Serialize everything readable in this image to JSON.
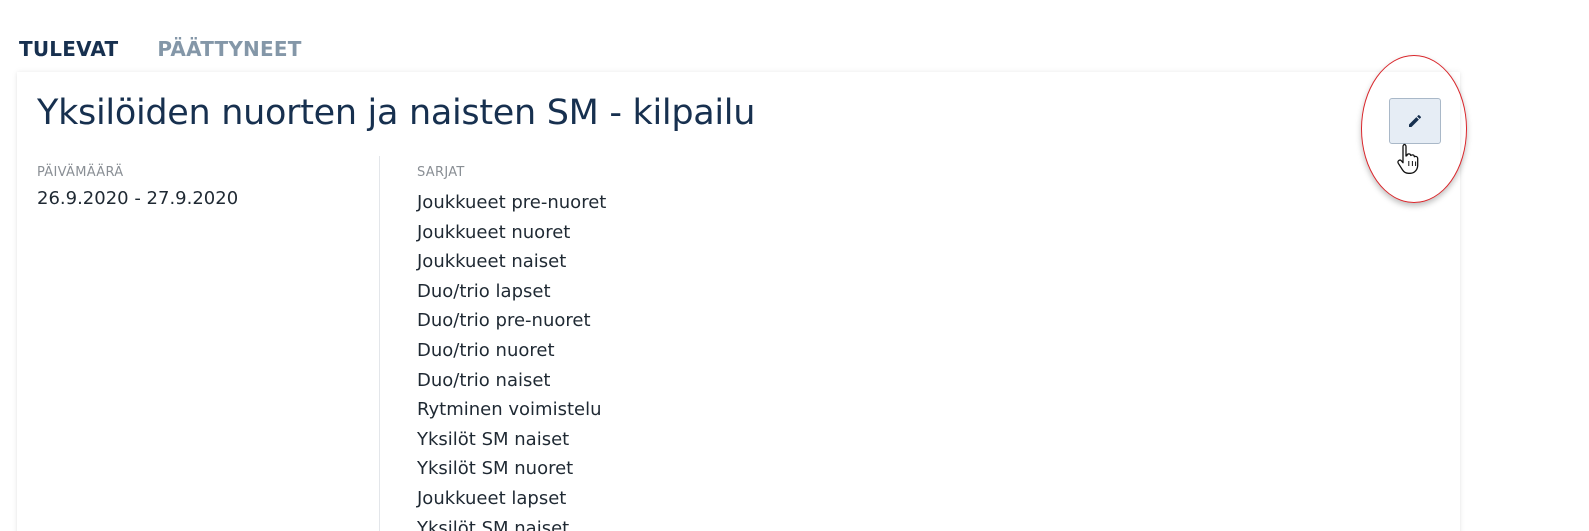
{
  "tabs": [
    {
      "label": "TULEVAT",
      "active": true
    },
    {
      "label": "PÄÄTTYNEET",
      "active": false
    }
  ],
  "competition": {
    "title": "Yksilöiden nuorten ja naisten SM - kilpailu",
    "date_label": "PÄIVÄMÄÄRÄ",
    "date_value": "26.9.2020 - 27.9.2020",
    "series_label": "SARJAT",
    "series": [
      "Joukkueet pre-nuoret",
      "Joukkueet nuoret",
      "Joukkueet naiset",
      "Duo/trio lapset",
      "Duo/trio pre-nuoret",
      "Duo/trio nuoret",
      "Duo/trio naiset",
      "Rytminen voimistelu",
      "Yksilöt SM naiset",
      "Yksilöt SM nuoret",
      "Joukkueet lapset",
      "Yksilöt SM naiset"
    ]
  },
  "edit_button": {
    "icon": "pencil-icon"
  },
  "colors": {
    "title": "#17304f",
    "tab_active": "#17304f",
    "tab_inactive": "#8497a8",
    "edit_button_bg": "#e6edf5",
    "annotation_ring": "#d9262b"
  }
}
